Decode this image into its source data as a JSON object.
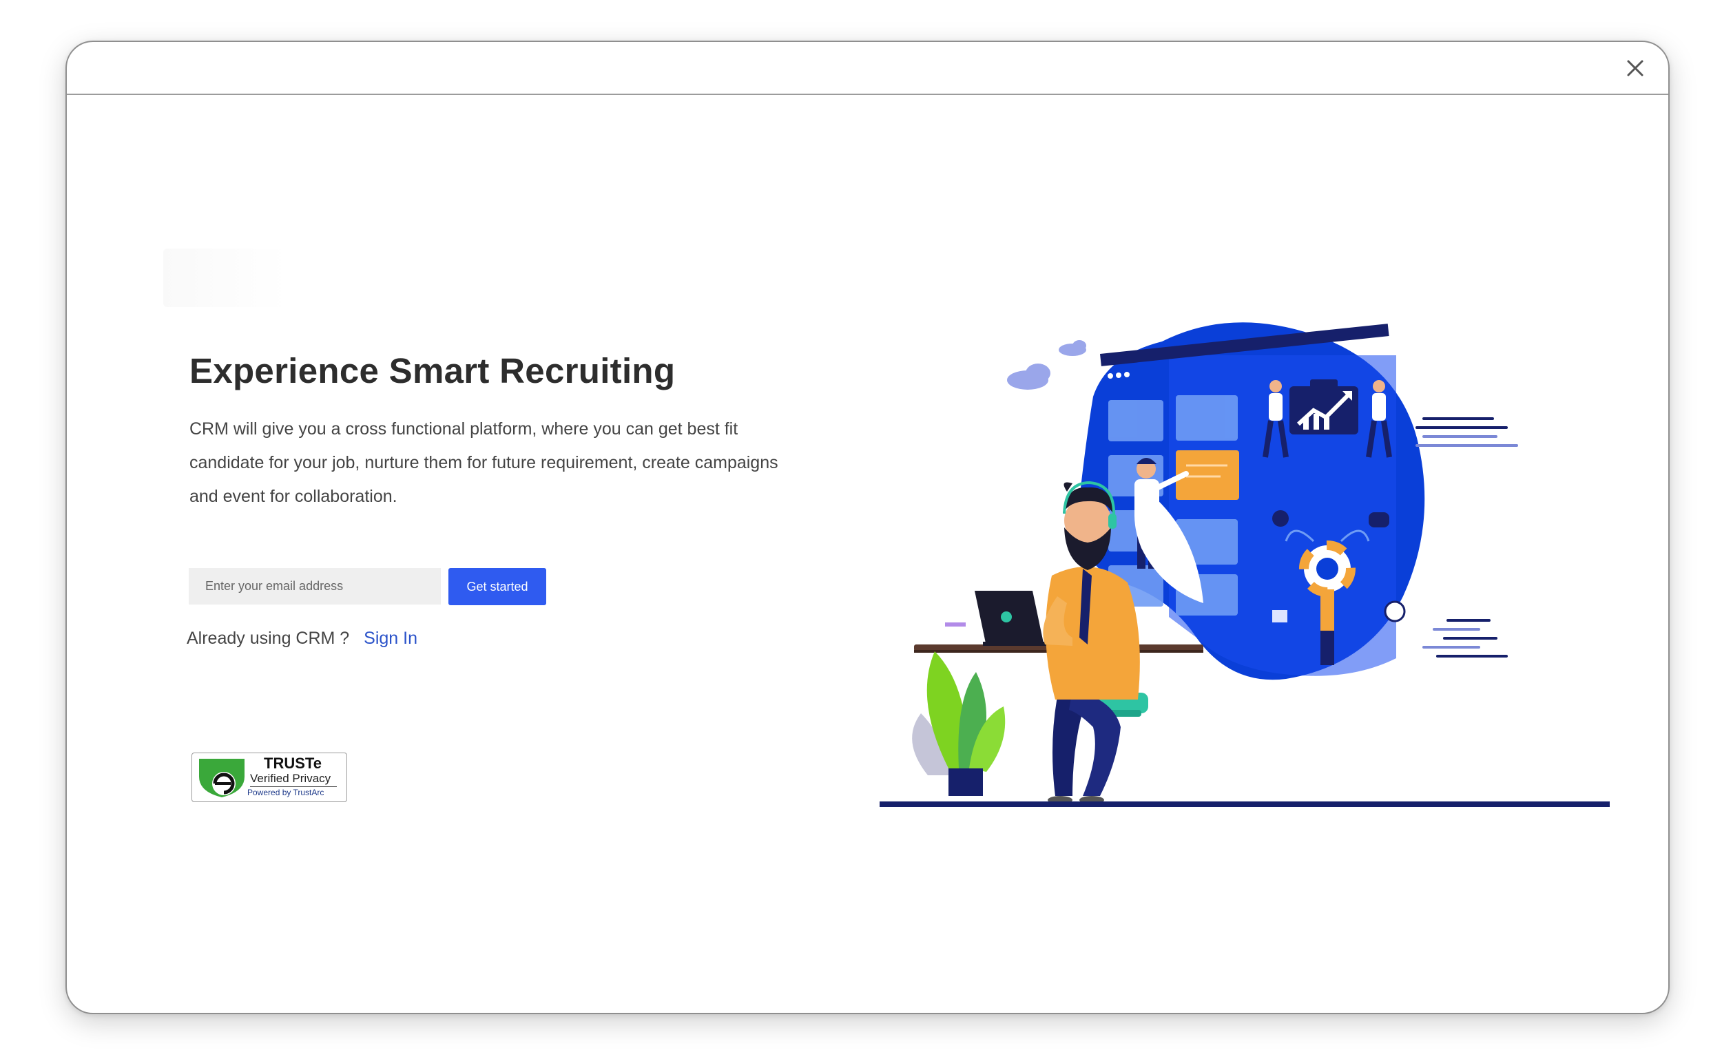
{
  "window": {
    "close_icon": "close-icon"
  },
  "hero": {
    "headline": "Experience Smart Recruiting",
    "description": "CRM will give you a cross functional platform, where you can get best fit candidate for your job, nurture them for future requirement, create campaigns and event for collaboration."
  },
  "signup": {
    "email_placeholder": "Enter your email address",
    "email_value": "",
    "cta_label": "Get started"
  },
  "signin": {
    "prompt": "Already using CRM ?",
    "link_label": "Sign In"
  },
  "badge": {
    "title": "TRUSTe",
    "subtitle": "Verified Privacy",
    "powered": "Powered by TrustArc"
  },
  "colors": {
    "accent": "#2f5bf0",
    "link": "#2a52c9",
    "illustration_blue": "#0a3fd8",
    "illustration_navy": "#16206b",
    "truste_green": "#3aa83a"
  }
}
